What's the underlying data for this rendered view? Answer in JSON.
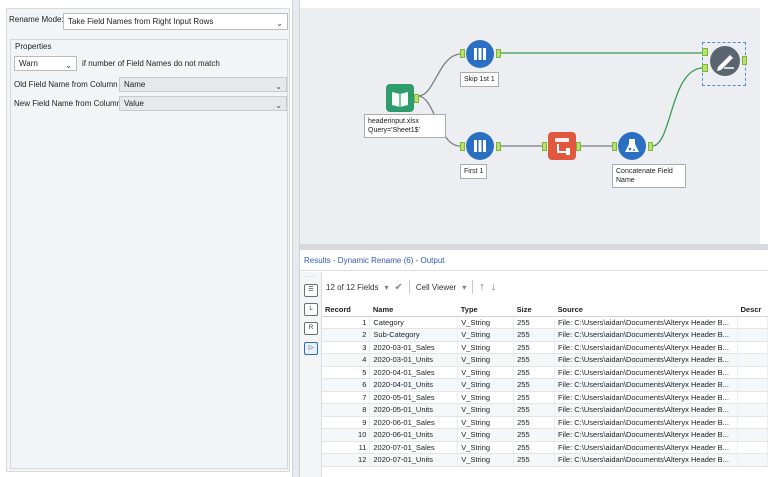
{
  "config": {
    "rename_mode_label": "Rename Mode:",
    "rename_mode_value": "Take Field Names from Right Input Rows",
    "properties_label": "Properties",
    "warn_value": "Warn",
    "warn_text": "if number of Field Names do not match",
    "old_field_label": "Old Field Name from Column",
    "old_field_value": "Name",
    "new_field_label": "New Field Name from Column",
    "new_field_value": "Value"
  },
  "canvas": {
    "tools": [
      {
        "name": "input",
        "label": "headerinput.xlsx Query='Sheet1$'",
        "icon": "book-icon"
      },
      {
        "name": "skip",
        "label": "Skip 1st 1",
        "icon": "sample-icon"
      },
      {
        "name": "first",
        "label": "First 1",
        "icon": "sample-icon"
      },
      {
        "name": "transpose",
        "label": "",
        "icon": "transpose-icon"
      },
      {
        "name": "formula",
        "label": "Concatenate Field Name",
        "icon": "flask-icon"
      },
      {
        "name": "dynamic-rename",
        "label": "",
        "icon": "dynamic-rename-icon"
      }
    ]
  },
  "results": {
    "title": "Results - Dynamic Rename (6) - Output",
    "fields_count": "12 of 12 Fields",
    "cell_viewer": "Cell Viewer",
    "columns": [
      "Record",
      "Name",
      "Type",
      "Size",
      "Source",
      "Descr"
    ],
    "rows": [
      [
        "1",
        "Category",
        "V_String",
        "255",
        "File: C:\\Users\\aidan\\Documents\\Alteryx Header B...",
        ""
      ],
      [
        "2",
        "Sub-Category",
        "V_String",
        "255",
        "File: C:\\Users\\aidan\\Documents\\Alteryx Header B...",
        ""
      ],
      [
        "3",
        "2020-03-01_Sales",
        "V_String",
        "255",
        "File: C:\\Users\\aidan\\Documents\\Alteryx Header B...",
        ""
      ],
      [
        "4",
        "2020-03-01_Units",
        "V_String",
        "255",
        "File: C:\\Users\\aidan\\Documents\\Alteryx Header B...",
        ""
      ],
      [
        "5",
        "2020-04-01_Sales",
        "V_String",
        "255",
        "File: C:\\Users\\aidan\\Documents\\Alteryx Header B...",
        ""
      ],
      [
        "6",
        "2020-04-01_Units",
        "V_String",
        "255",
        "File: C:\\Users\\aidan\\Documents\\Alteryx Header B...",
        ""
      ],
      [
        "7",
        "2020-05-01_Sales",
        "V_String",
        "255",
        "File: C:\\Users\\aidan\\Documents\\Alteryx Header B...",
        ""
      ],
      [
        "8",
        "2020-05-01_Units",
        "V_String",
        "255",
        "File: C:\\Users\\aidan\\Documents\\Alteryx Header B...",
        ""
      ],
      [
        "9",
        "2020-06-01_Sales",
        "V_String",
        "255",
        "File: C:\\Users\\aidan\\Documents\\Alteryx Header B...",
        ""
      ],
      [
        "10",
        "2020-06-01_Units",
        "V_String",
        "255",
        "File: C:\\Users\\aidan\\Documents\\Alteryx Header B...",
        ""
      ],
      [
        "11",
        "2020-07-01_Sales",
        "V_String",
        "255",
        "File: C:\\Users\\aidan\\Documents\\Alteryx Header B...",
        ""
      ],
      [
        "12",
        "2020-07-01_Units",
        "V_String",
        "255",
        "File: C:\\Users\\aidan\\Documents\\Alteryx Header B...",
        ""
      ]
    ]
  }
}
